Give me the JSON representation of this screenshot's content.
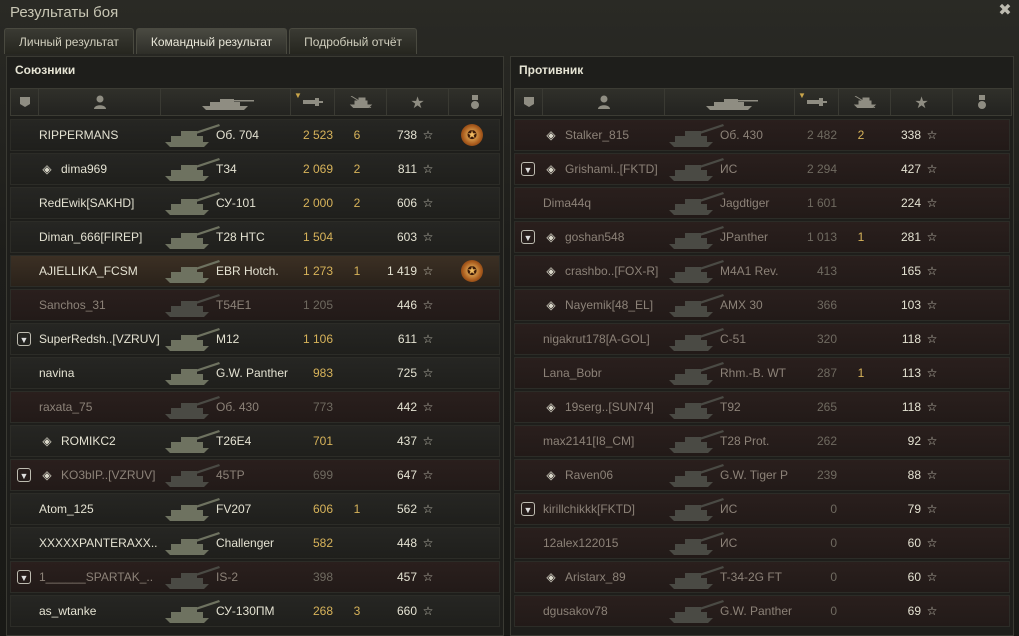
{
  "window": {
    "title": "Результаты боя",
    "close_glyph": "✖"
  },
  "tabs": [
    {
      "label": "Личный результат",
      "active": false
    },
    {
      "label": "Командный результат",
      "active": true
    },
    {
      "label": "Подробный отчёт",
      "active": false
    }
  ],
  "header_icons": [
    "platoon-icon",
    "player-icon",
    "tank-icon",
    "damage-icon",
    "frags-icon",
    "xp-star-icon",
    "achievement-icon"
  ],
  "colors": {
    "gold": "#d7b35a",
    "dead_row": "#2a1f1d",
    "own_row": "#3c3024"
  },
  "allies": {
    "title": "Союзники",
    "rows": [
      {
        "name": "RIPPERMANS",
        "tank": "Об. 704",
        "damage": "2 523",
        "frags": "6",
        "xp": "738",
        "medal": true,
        "medal_count": "2",
        "dead": false
      },
      {
        "name": "dima969",
        "tank": "T34",
        "damage": "2 069",
        "frags": "2",
        "xp": "811",
        "rank": true,
        "dead": false
      },
      {
        "name": "RedEwik[SAKHD]",
        "tank": "СУ-101",
        "damage": "2 000",
        "frags": "2",
        "xp": "606",
        "dead": false
      },
      {
        "name": "Diman_666[FIREP]",
        "tank": "T28 HTC",
        "damage": "1 504",
        "frags": "",
        "xp": "603",
        "dead": false
      },
      {
        "name": "AJIELLIKA_FCSM",
        "tank": "EBR Hotch.",
        "damage": "1 273",
        "frags": "1",
        "xp": "1 419",
        "medal": true,
        "medal_count": "2",
        "me": true,
        "dead": false
      },
      {
        "name": "Sanchos_31",
        "tank": "T54E1",
        "damage": "1 205",
        "frags": "",
        "xp": "446",
        "dead": true
      },
      {
        "name": "SuperRedsh..[VZRUV]",
        "tank": "M12",
        "damage": "1 106",
        "frags": "",
        "xp": "611",
        "platoon": true,
        "dead": false
      },
      {
        "name": "navina",
        "tank": "G.W. Panther",
        "damage": "983",
        "frags": "",
        "xp": "725",
        "dead": false
      },
      {
        "name": "raxata_75",
        "tank": "Об. 430",
        "damage": "773",
        "frags": "",
        "xp": "442",
        "dead": true
      },
      {
        "name": "ROMIKC2",
        "tank": "T26E4",
        "damage": "701",
        "frags": "",
        "xp": "437",
        "rank": true,
        "dead": false
      },
      {
        "name": "KO3bIP..[VZRUV]",
        "tank": "45TP",
        "damage": "699",
        "frags": "",
        "xp": "647",
        "platoon": true,
        "rank": true,
        "dead": true
      },
      {
        "name": "Atom_125",
        "tank": "FV207",
        "damage": "606",
        "frags": "1",
        "xp": "562",
        "dead": false
      },
      {
        "name": "XXXXXPANTERAXX..",
        "tank": "Challenger",
        "damage": "582",
        "frags": "",
        "xp": "448",
        "dead": false
      },
      {
        "name": "1______SPARTAK_..",
        "tank": "IS-2",
        "damage": "398",
        "frags": "",
        "xp": "457",
        "platoon": true,
        "dead": true
      },
      {
        "name": "as_wtanke",
        "tank": "СУ-130ПМ",
        "damage": "268",
        "frags": "3",
        "xp": "660",
        "dead": false
      }
    ]
  },
  "enemies": {
    "title": "Противник",
    "rows": [
      {
        "name": "Stalker_815",
        "tank": "Об. 430",
        "damage": "2 482",
        "frags": "2",
        "xp": "338",
        "rank": true,
        "dead": true
      },
      {
        "name": "Grishami..[FKTD]",
        "tank": "ИС",
        "damage": "2 294",
        "frags": "",
        "xp": "427",
        "platoon": true,
        "rank": true,
        "dead": true
      },
      {
        "name": "Dima44q",
        "tank": "Jagdtiger",
        "damage": "1 601",
        "frags": "",
        "xp": "224",
        "dead": true
      },
      {
        "name": "goshan548",
        "tank": "JPanther",
        "damage": "1 013",
        "frags": "1",
        "xp": "281",
        "platoon": true,
        "rank": true,
        "dead": true
      },
      {
        "name": "crashbo..[FOX-R]",
        "tank": "M4A1 Rev.",
        "damage": "413",
        "frags": "",
        "xp": "165",
        "rank": true,
        "dead": true
      },
      {
        "name": "Nayemik[48_EL]",
        "tank": "AMX 30",
        "damage": "366",
        "frags": "",
        "xp": "103",
        "rank": true,
        "dead": true
      },
      {
        "name": "nigakrut178[A-GOL]",
        "tank": "C-51",
        "damage": "320",
        "frags": "",
        "xp": "118",
        "dead": true
      },
      {
        "name": "Lana_Bobr",
        "tank": "Rhm.-B. WT",
        "damage": "287",
        "frags": "1",
        "xp": "113",
        "dead": true
      },
      {
        "name": "19serg..[SUN74]",
        "tank": "T92",
        "damage": "265",
        "frags": "",
        "xp": "118",
        "rank": true,
        "dead": true
      },
      {
        "name": "max2141[I8_CM]",
        "tank": "T28 Prot.",
        "damage": "262",
        "frags": "",
        "xp": "92",
        "dead": true
      },
      {
        "name": "Raven06",
        "tank": "G.W. Tiger P",
        "damage": "239",
        "frags": "",
        "xp": "88",
        "rank": true,
        "dead": true
      },
      {
        "name": "kirillchikkk[FKTD]",
        "tank": "ИС",
        "damage": "0",
        "frags": "",
        "xp": "79",
        "platoon": true,
        "dead": true
      },
      {
        "name": "12alex122015",
        "tank": "ИС",
        "damage": "0",
        "frags": "",
        "xp": "60",
        "dead": true
      },
      {
        "name": "Aristarx_89",
        "tank": "T-34-2G FT",
        "damage": "0",
        "frags": "",
        "xp": "60",
        "rank": true,
        "dead": true
      },
      {
        "name": "dgusakov78",
        "tank": "G.W. Panther",
        "damage": "0",
        "frags": "",
        "xp": "69",
        "dead": true
      }
    ]
  },
  "star_glyph": "☆"
}
